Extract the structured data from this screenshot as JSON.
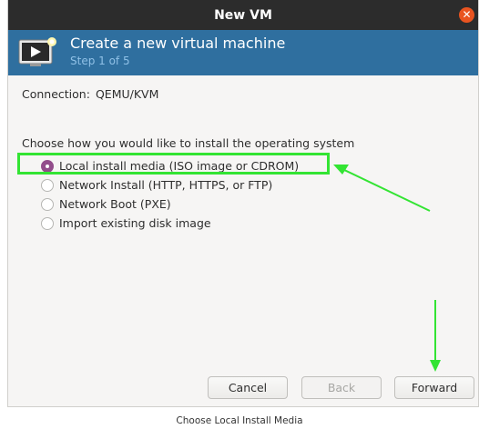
{
  "window": {
    "title": "New VM",
    "close_icon": "close-icon"
  },
  "banner": {
    "icon": "virtual-machine-monitor-icon",
    "title": "Create a new virtual machine",
    "step": "Step 1 of 5"
  },
  "connection": {
    "label": "Connection:",
    "value": "QEMU/KVM"
  },
  "install": {
    "prompt": "Choose how you would like to install the operating system",
    "options": [
      {
        "label": "Local install media (ISO image or CDROM)",
        "selected": true
      },
      {
        "label": "Network Install (HTTP, HTTPS, or FTP)",
        "selected": false
      },
      {
        "label": "Network Boot (PXE)",
        "selected": false
      },
      {
        "label": "Import existing disk image",
        "selected": false
      }
    ]
  },
  "buttons": {
    "cancel": "Cancel",
    "back": "Back",
    "forward": "Forward",
    "back_enabled": false
  },
  "annotations": {
    "highlight_color": "#33e433",
    "accent_radio_color": "#924d8b"
  },
  "caption": "Choose Local Install Media"
}
